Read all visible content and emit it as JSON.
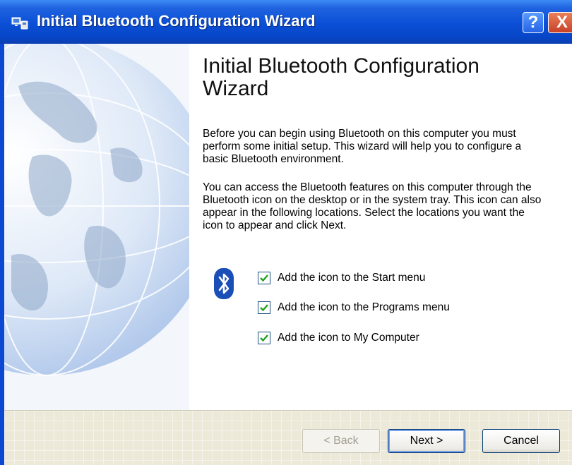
{
  "window": {
    "title": "Initial Bluetooth Configuration Wizard",
    "help_label": "?",
    "close_label": "X"
  },
  "content": {
    "heading": "Initial Bluetooth Configuration Wizard",
    "intro": "Before you can begin using Bluetooth on this computer you must perform some initial setup. This wizard will help you to configure a basic Bluetooth environment.",
    "details": "You can access the Bluetooth features on this computer through the Bluetooth icon on the desktop or in the system tray. This icon can also appear in the following locations. Select the locations you want the icon to appear and click Next.",
    "options": [
      {
        "label": "Add the icon to the Start menu",
        "checked": true
      },
      {
        "label": "Add the icon to the Programs menu",
        "checked": true
      },
      {
        "label": "Add the icon to My Computer",
        "checked": true
      }
    ]
  },
  "buttons": {
    "back": "< Back",
    "next": "Next >",
    "cancel": "Cancel"
  },
  "icons": {
    "title": "bluetooth-devices-icon",
    "option_group": "bluetooth-icon"
  },
  "colors": {
    "titlebar": "#0a4fd6",
    "bluetooth": "#1a4fb8",
    "footer": "#ece9d8"
  }
}
